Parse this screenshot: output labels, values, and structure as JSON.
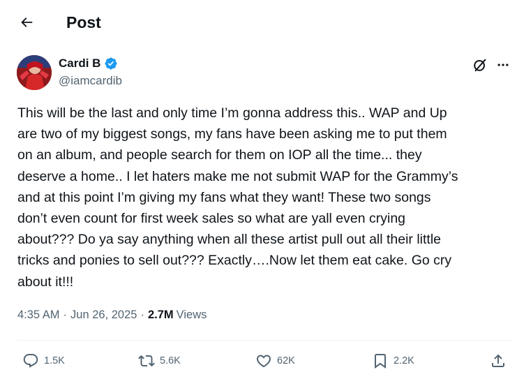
{
  "header": {
    "title": "Post"
  },
  "author": {
    "name": "Cardi B",
    "handle": "@iamcardib",
    "verified": true,
    "verified_color": "#1d9bf0"
  },
  "post": {
    "text": "This will be the last and only time I’m gonna address this.. WAP and Up\nare two of my biggest songs, my fans have been asking me to put them\non an album,  and people search for them on IOP all the time... they\ndeserve a home.. I let haters make me not submit WAP for the Grammy’s\nand at this point I’m giving my fans what they want! These two songs\ndon’t even count for first week sales so what are yall even crying\nabout??? Do ya say anything when all these artist pull out all their little\ntricks and ponies to sell out??? Exactly….Now let them eat cake. Go cry\nabout it!!!",
    "time": "4:35 AM",
    "date": "Jun 26, 2025",
    "separator": "·",
    "views_count": "2.7M",
    "views_label": "Views"
  },
  "actions": {
    "replies": "1.5K",
    "reposts": "5.6K",
    "likes": "62K",
    "bookmarks": "2.2K"
  },
  "icons": {
    "back": "arrow-left-icon",
    "grok": "grok-icon",
    "more": "more-horizontal-icon",
    "reply": "reply-icon",
    "repost": "repost-icon",
    "like": "heart-icon",
    "bookmark": "bookmark-icon",
    "share": "share-icon"
  },
  "colors": {
    "text_primary": "#0f1419",
    "text_secondary": "#536471",
    "divider": "#eff3f4",
    "avatar_bg": "#a51f22"
  }
}
